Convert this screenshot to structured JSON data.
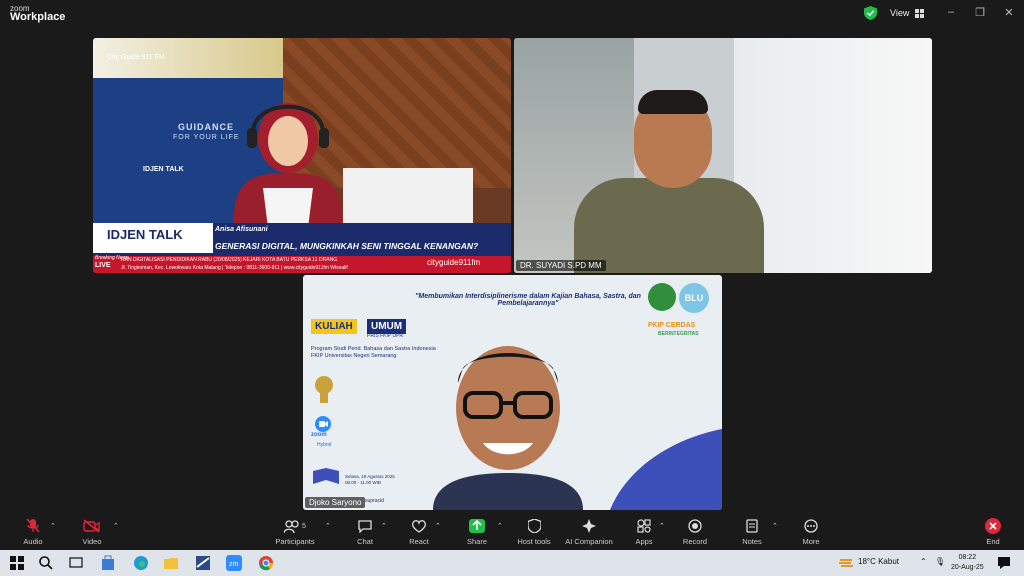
{
  "app": {
    "brand_top": "zoom",
    "brand_bottom": "Workplace",
    "view_label": "View"
  },
  "tiles": [
    {
      "name": "",
      "content": {
        "citytag": "City Guide 911 FM",
        "guidance": "GUIDANCE",
        "tagline": "FOR YOUR LIFE",
        "small_label": "IDJEN TALK",
        "show_logo": "IDJEN TALK",
        "host": "Anisa Afisunani",
        "headline": "GENERASI DIGITAL, MUNGKINKAH SENI TINGGAL KENANGAN?",
        "breaking": "Breaking News",
        "live": "LIVE",
        "ticker1": "RAN DIGITALISASI PENDIDIKAN     RABU (20/08/2025) KEJARI KOTA BATU PERKSA 11 ORANG",
        "ticker2": "Jl. Tingkoman, Kec. Lowokwaru Kota Malang | Telepon : 0811-3600-911 | www.cityguide911fm Wisnalif",
        "cityguide": "cityguide911fm"
      }
    },
    {
      "name": "DR. SUYADI S.PD MM"
    },
    {
      "name": "Djoko Saryono",
      "content": {
        "quote": "\"Membumikan Interdisiplinerisme dalam Kajian Bahasa, Sastra, dan Pembelajarannya\"",
        "kuliah": "KULIAH",
        "umum": "UMUM",
        "pris": "PRIS FKIP UPR",
        "program_line1": "Program Studi Pend. Bahasa dan Sastra Indonesia",
        "program_line2": "FKIP Universitas Negeri Semarang",
        "zoom": "zoom",
        "hybrid": "Hybrid",
        "date_line1": "Selasa, 19 Agustus 2025",
        "date_line2": "08.00 - 11.00 WIB",
        "credit": "supracid",
        "fip": "FKIP CERDAS",
        "fip_sub": "BERINTEGRITAS",
        "blu": "BLU"
      }
    }
  ],
  "toolbar": {
    "audio": "Audio",
    "video": "Video",
    "participants": "Participants",
    "participants_count": "5",
    "chat": "Chat",
    "react": "React",
    "share": "Share",
    "host_tools": "Host tools",
    "ai_companion": "AI Companion",
    "apps": "Apps",
    "record": "Record",
    "notes": "Notes",
    "more": "More",
    "end": "End"
  },
  "taskbar": {
    "weather": "18°C  Kabut",
    "time": "08:22",
    "date": "20-Aug-25"
  },
  "colors": {
    "accent": "#2d8cff",
    "end": "#e0263b",
    "share": "#1fbf4a"
  }
}
